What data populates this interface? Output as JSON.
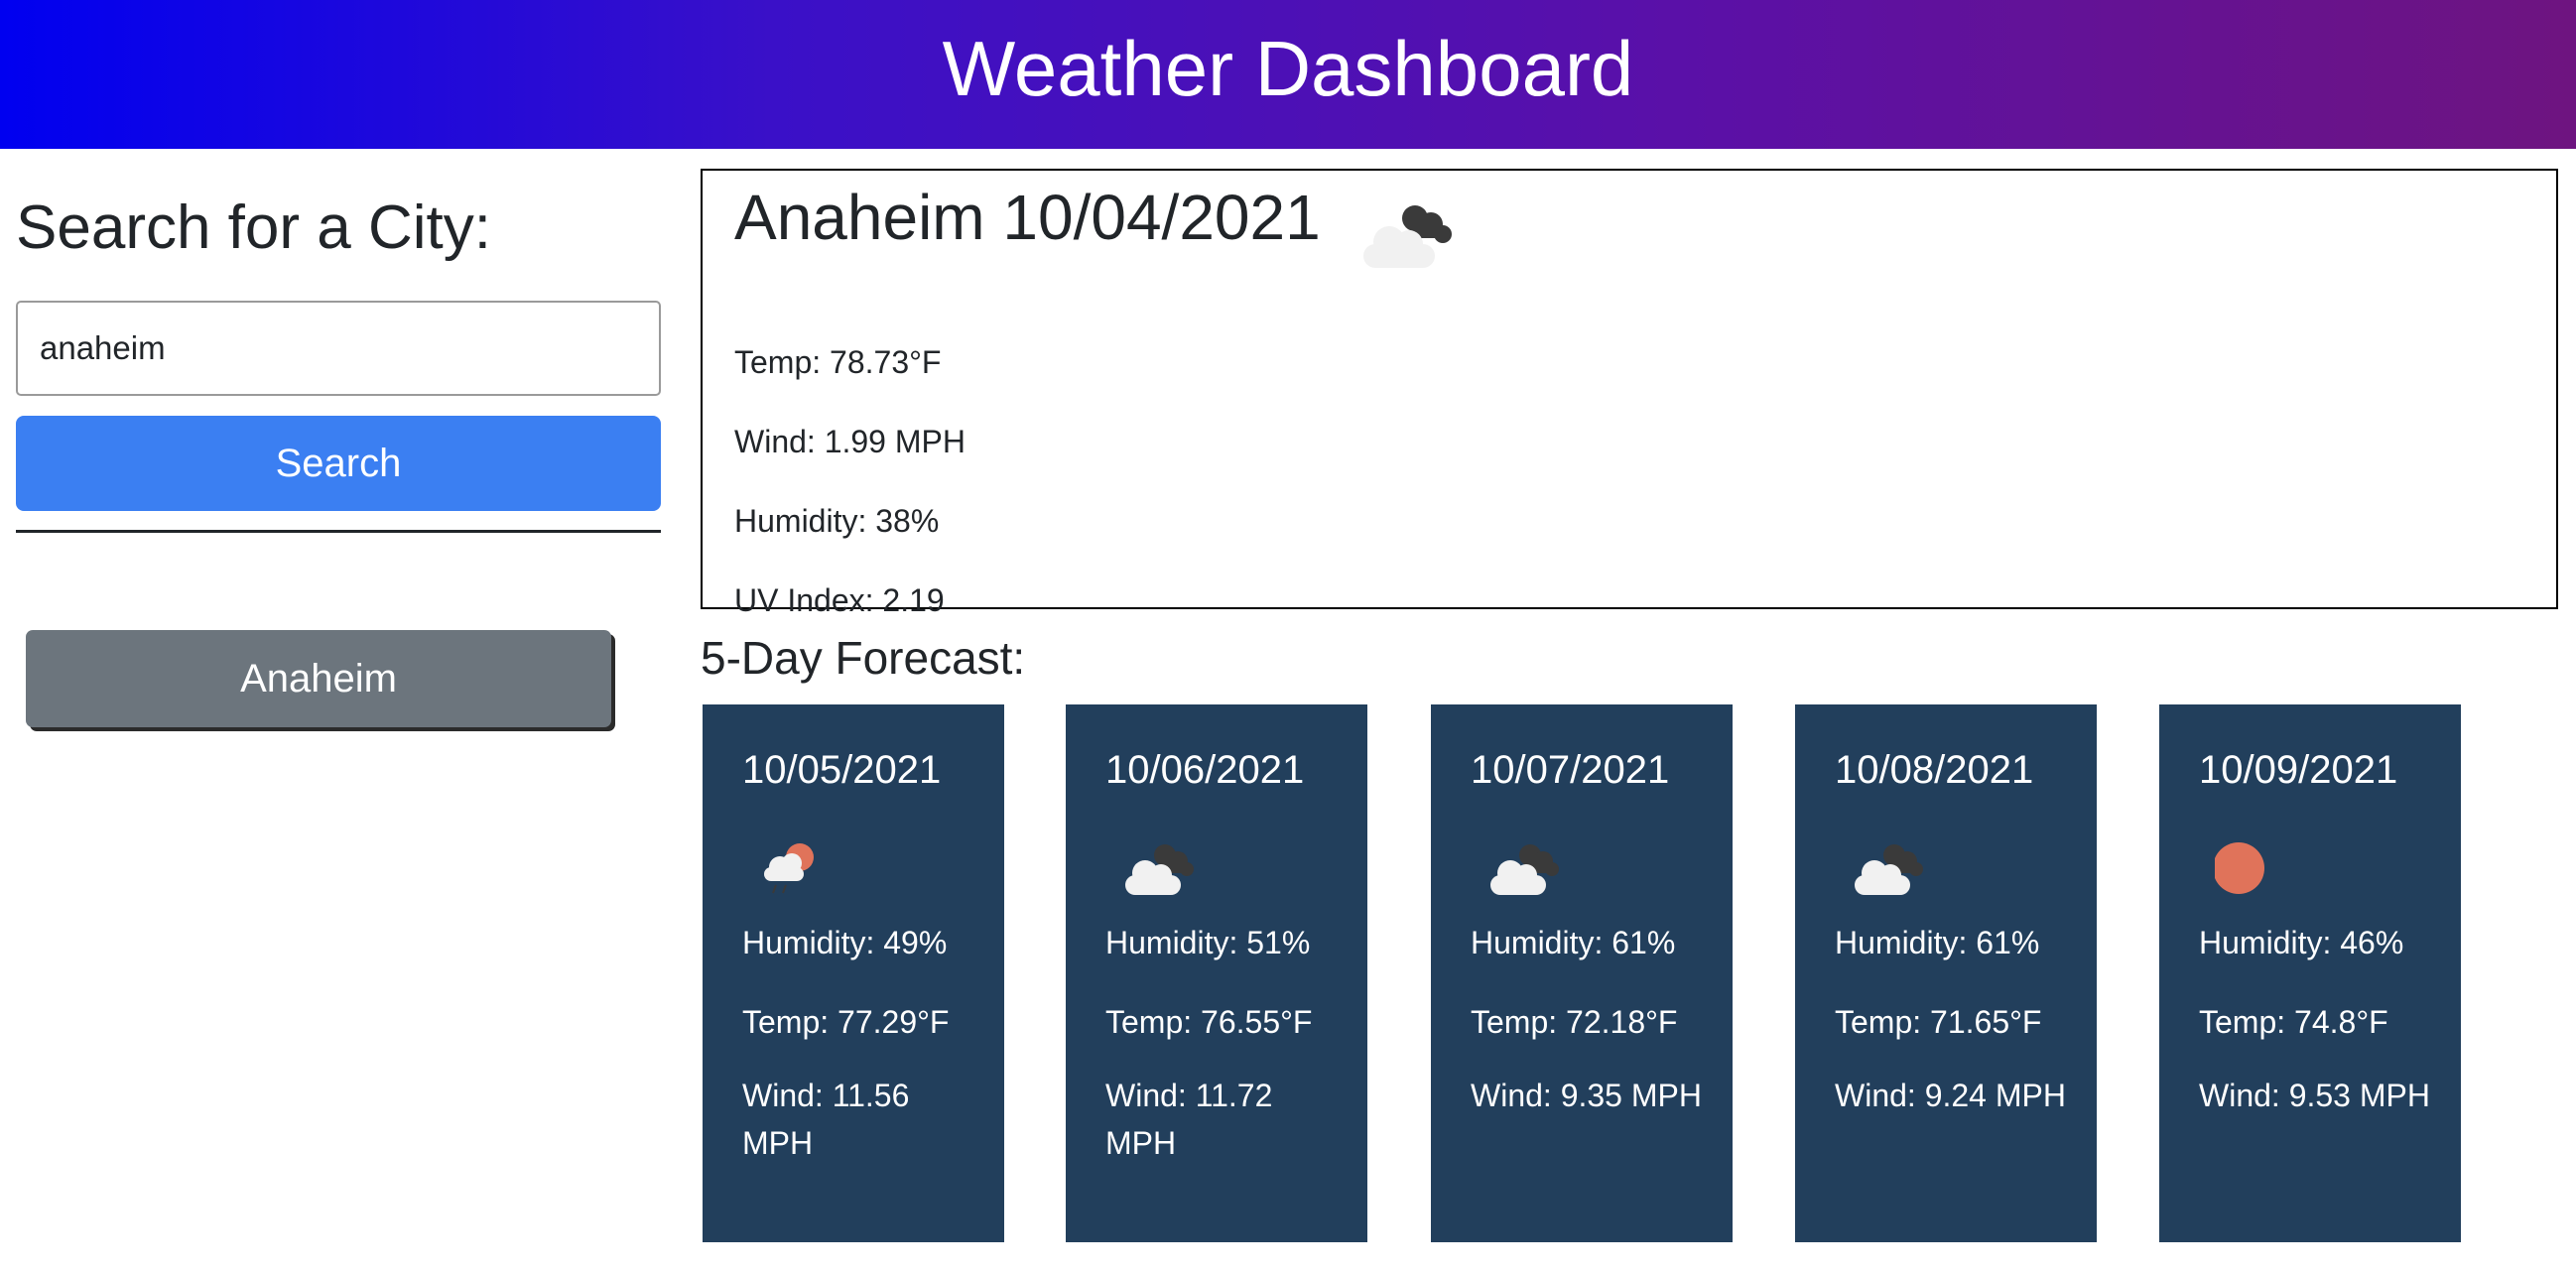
{
  "header": {
    "title": "Weather Dashboard",
    "gradient_start": "#0000f0",
    "gradient_end": "#6e1480"
  },
  "sidebar": {
    "heading": "Search for a City:",
    "search_value": "anaheim",
    "search_button": "Search",
    "history": [
      "Anaheim"
    ],
    "search_button_color": "#3b7ff2",
    "history_button_color": "#6c757d"
  },
  "current": {
    "title": "Anaheim 10/04/2021",
    "icon": "broken-clouds-icon",
    "temp": "Temp: 78.73°F",
    "wind": "Wind: 1.99 MPH",
    "humidity": "Humidity: 38%",
    "uv": "UV Index: 2.19"
  },
  "forecast": {
    "title": "5-Day Forecast:",
    "card_color": "#223f5c",
    "days": [
      {
        "date": "10/05/2021",
        "icon": "rain-sun-icon",
        "humidity": "Humidity: 49%",
        "temp": "Temp: 77.29°F",
        "wind": "Wind: 11.56 MPH"
      },
      {
        "date": "10/06/2021",
        "icon": "broken-clouds-icon",
        "humidity": "Humidity: 51%",
        "temp": "Temp: 76.55°F",
        "wind": "Wind: 11.72 MPH"
      },
      {
        "date": "10/07/2021",
        "icon": "broken-clouds-icon",
        "humidity": "Humidity: 61%",
        "temp": "Temp: 72.18°F",
        "wind": "Wind: 9.35 MPH"
      },
      {
        "date": "10/08/2021",
        "icon": "broken-clouds-icon",
        "humidity": "Humidity: 61%",
        "temp": "Temp: 71.65°F",
        "wind": "Wind: 9.24 MPH"
      },
      {
        "date": "10/09/2021",
        "icon": "clear-sun-icon",
        "humidity": "Humidity: 46%",
        "temp": "Temp: 74.8°F",
        "wind": "Wind: 9.53 MPH"
      }
    ]
  }
}
